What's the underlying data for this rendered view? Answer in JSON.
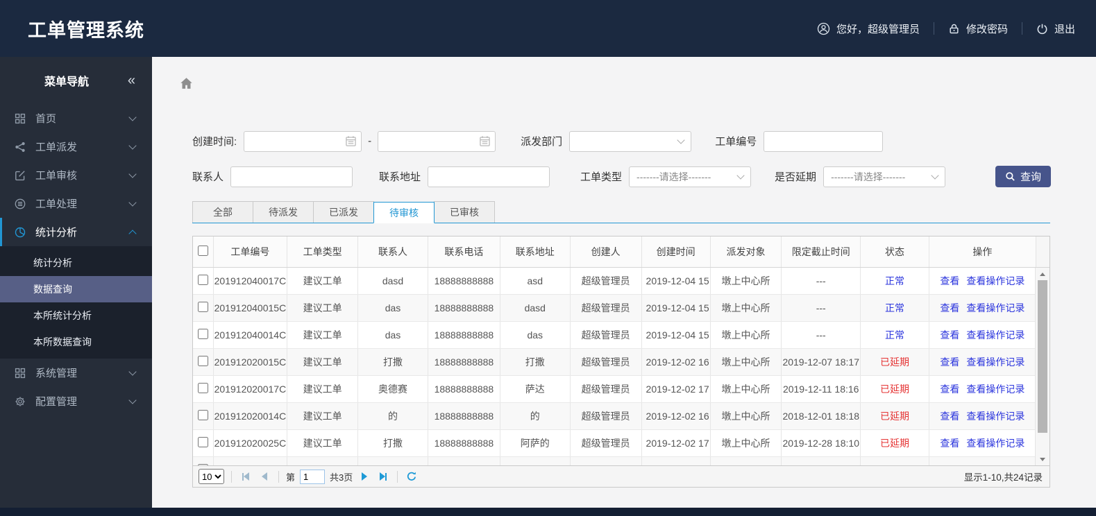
{
  "header": {
    "title": "工单管理系统",
    "greeting": "您好，超级管理员",
    "change_password": "修改密码",
    "logout": "退出"
  },
  "sidebar": {
    "nav_title": "菜单导航",
    "collapse_glyph": "«",
    "items": [
      {
        "key": "home",
        "label": "首页",
        "icon": "grid-icon",
        "expanded": false
      },
      {
        "key": "order-dispatch",
        "label": "工单派发",
        "icon": "share-icon",
        "expanded": false
      },
      {
        "key": "order-review",
        "label": "工单审核",
        "icon": "edit-icon",
        "expanded": false
      },
      {
        "key": "order-process",
        "label": "工单处理",
        "icon": "process-icon",
        "expanded": false
      },
      {
        "key": "stats-analysis",
        "label": "统计分析",
        "icon": "pie-chart-icon",
        "expanded": true,
        "active": true,
        "children": [
          "统计分析",
          "数据查询",
          "本所统计分析",
          "本所数据查询"
        ],
        "child_keys": [
          "stats-analysis",
          "data-query",
          "branch-stats-analysis",
          "branch-data-query"
        ],
        "active_child": "数据查询"
      },
      {
        "key": "system-mgmt",
        "label": "系统管理",
        "icon": "grid-icon",
        "expanded": false
      },
      {
        "key": "config-mgmt",
        "label": "配置管理",
        "icon": "gear-icon",
        "expanded": false
      }
    ]
  },
  "filters": {
    "create_time_label": "创建时间:",
    "range_separator": "-",
    "dispatch_dept_label": "派发部门",
    "order_no_label": "工单编号",
    "contact_label": "联系人",
    "address_label": "联系地址",
    "order_type_label": "工单类型",
    "delay_label": "是否延期",
    "select_placeholder": "-------请选择-------",
    "search_button": "查询"
  },
  "tabs": [
    {
      "key": "all",
      "label": "全部",
      "active": false
    },
    {
      "key": "pending-dispatch",
      "label": "待派发",
      "active": false
    },
    {
      "key": "dispatched",
      "label": "已派发",
      "active": false
    },
    {
      "key": "pending-review",
      "label": "待审核",
      "active": true
    },
    {
      "key": "reviewed",
      "label": "已审核",
      "active": false
    }
  ],
  "table": {
    "columns": [
      "工单编号",
      "工单类型",
      "联系人",
      "联系电话",
      "联系地址",
      "创建人",
      "创建时间",
      "派发对象",
      "限定截止时间",
      "状态",
      "操作"
    ],
    "action_labels": [
      "查看",
      "查看操作记录"
    ],
    "rows": [
      {
        "order_no": "201912040017C",
        "type": "建议工单",
        "contact": "dasd",
        "phone": "18888888888",
        "address": "asd",
        "creator": "超级管理员",
        "created": "2019-12-04 15",
        "target": "墩上中心所",
        "deadline": "---",
        "status": "正常",
        "delayed": false
      },
      {
        "order_no": "201912040015C",
        "type": "建议工单",
        "contact": "das",
        "phone": "18888888888",
        "address": "dasd",
        "creator": "超级管理员",
        "created": "2019-12-04 15",
        "target": "墩上中心所",
        "deadline": "---",
        "status": "正常",
        "delayed": false
      },
      {
        "order_no": "201912040014C",
        "type": "建议工单",
        "contact": "das",
        "phone": "18888888888",
        "address": "das",
        "creator": "超级管理员",
        "created": "2019-12-04 15",
        "target": "墩上中心所",
        "deadline": "---",
        "status": "正常",
        "delayed": false
      },
      {
        "order_no": "201912020015C",
        "type": "建议工单",
        "contact": "打撒",
        "phone": "18888888888",
        "address": "打撒",
        "creator": "超级管理员",
        "created": "2019-12-02 16",
        "target": "墩上中心所",
        "deadline": "2019-12-07 18:17",
        "status": "已延期",
        "delayed": true
      },
      {
        "order_no": "201912020017C",
        "type": "建议工单",
        "contact": "奥德赛",
        "phone": "18888888888",
        "address": "萨达",
        "creator": "超级管理员",
        "created": "2019-12-02 17",
        "target": "墩上中心所",
        "deadline": "2019-12-11 18:16",
        "status": "已延期",
        "delayed": true
      },
      {
        "order_no": "201912020014C",
        "type": "建议工单",
        "contact": "的",
        "phone": "18888888888",
        "address": "的",
        "creator": "超级管理员",
        "created": "2019-12-02 16",
        "target": "墩上中心所",
        "deadline": "2018-12-01 18:18",
        "status": "已延期",
        "delayed": true
      },
      {
        "order_no": "201912020025C",
        "type": "建议工单",
        "contact": "打撒",
        "phone": "18888888888",
        "address": "阿萨的",
        "creator": "超级管理员",
        "created": "2019-12-02 17",
        "target": "墩上中心所",
        "deadline": "2019-12-28 18:10",
        "status": "已延期",
        "delayed": true
      }
    ]
  },
  "pagination": {
    "page_size": "10",
    "page_prefix": "第",
    "page_value": "1",
    "total_pages": "共3页",
    "summary": "显示1-10,共24记录"
  },
  "colors": {
    "header_navy": "#1b2940",
    "sidebar_dark": "#262d39",
    "submenu_active": "#575f86",
    "accent_blue": "#2196d3",
    "link_blue": "#2b35dd",
    "status_red": "#e53333",
    "button_navy": "#46548b"
  }
}
